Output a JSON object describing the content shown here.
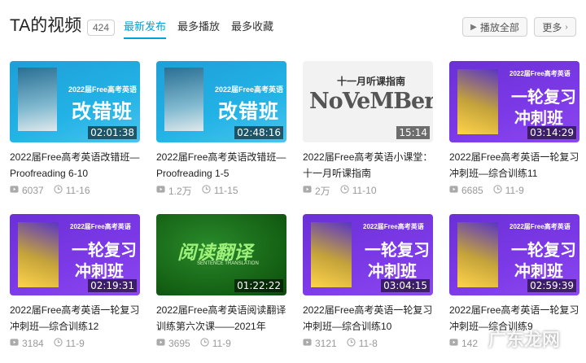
{
  "header": {
    "title": "TA的视频",
    "count": "424",
    "tabs": [
      "最新发布",
      "最多播放",
      "最多收藏"
    ],
    "play_all_label": "播放全部",
    "more_label": "更多"
  },
  "videos": [
    {
      "title": "2022届Free高考英语改错班—Proofreading 6-10",
      "duration": "02:01:38",
      "plays": "6037",
      "date": "11-16",
      "thumb": {
        "style": "blue",
        "sub": "2022届Free高考英语",
        "big": "改错班"
      }
    },
    {
      "title": "2022届Free高考英语改错班—Proofreading 1-5",
      "duration": "02:48:16",
      "plays": "1.2万",
      "date": "11-15",
      "thumb": {
        "style": "blue",
        "sub": "2022届Free高考英语",
        "big": "改错班"
      }
    },
    {
      "title": "2022届Free高考英语小课堂：十一月听课指南",
      "duration": "15:14",
      "plays": "2万",
      "date": "11-10",
      "thumb": {
        "style": "nov",
        "sub": "十一月听课指南",
        "big": "NoVeMBer"
      }
    },
    {
      "title": "2022届Free高考英语一轮复习冲刺班—综合训练11",
      "duration": "03:14:29",
      "plays": "6685",
      "date": "11-9",
      "thumb": {
        "style": "purple",
        "sub": "2022届Free高考英语",
        "big": "一轮复习",
        "big2": "冲刺班"
      }
    },
    {
      "title": "2022届Free高考英语一轮复习冲刺班—综合训练12",
      "duration": "02:19:31",
      "plays": "3184",
      "date": "11-9",
      "thumb": {
        "style": "purple",
        "sub": "2022届Free高考英语",
        "big": "一轮复习",
        "big2": "冲刺班"
      }
    },
    {
      "title": "2022届Free高考英语阅读翻译训练第六次课——2021年",
      "duration": "01:22:22",
      "plays": "3695",
      "date": "11-9",
      "thumb": {
        "style": "green",
        "sub": "SENTENCE TRANSLATION",
        "big": "阅读翻译"
      }
    },
    {
      "title": "2022届Free高考英语一轮复习冲刺班—综合训练10",
      "duration": "03:04:15",
      "plays": "3121",
      "date": "11-8",
      "thumb": {
        "style": "purple",
        "sub": "2022届Free高考英语",
        "big": "一轮复习",
        "big2": "冲刺班"
      }
    },
    {
      "title": "2022届Free高考英语一轮复习冲刺班—综合训练9",
      "duration": "02:59:39",
      "plays": "142",
      "date": "",
      "thumb": {
        "style": "purple",
        "sub": "2022届Free高考英语",
        "big": "一轮复习",
        "big2": "冲刺班"
      }
    }
  ],
  "watermark": "广东龙网",
  "colors": {
    "accent": "#00a1d6",
    "meta": "#999999"
  }
}
